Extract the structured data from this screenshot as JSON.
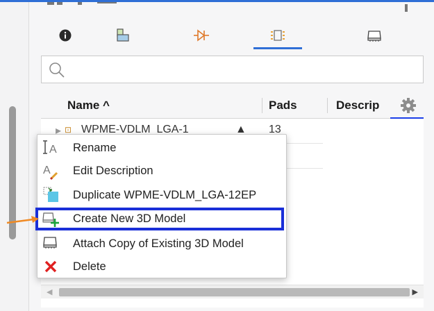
{
  "tabs": [
    {
      "icon": "info-icon"
    },
    {
      "icon": "component-icon"
    },
    {
      "icon": "schematic-symbol-icon"
    },
    {
      "icon": "footprint-icon",
      "active": true
    },
    {
      "icon": "3d-model-icon"
    }
  ],
  "search": {
    "placeholder": ""
  },
  "table": {
    "columns": {
      "name": "Name ^",
      "pads": "Pads",
      "description": "Descrip"
    },
    "rows": [
      {
        "name": "WPME-VDLM_LGA-1",
        "pads": "13"
      }
    ]
  },
  "context_menu": {
    "items": [
      {
        "label": "Rename",
        "icon": "rename-icon"
      },
      {
        "label": "Edit Description",
        "icon": "edit-description-icon"
      },
      {
        "label": "Duplicate WPME-VDLM_LGA-12EP",
        "icon": "duplicate-icon"
      },
      {
        "label": "Create New 3D Model",
        "icon": "create-3d-model-icon",
        "highlighted": true
      },
      {
        "label": "Attach Copy of Existing 3D Model",
        "icon": "attach-3d-model-icon"
      },
      {
        "label": "Delete",
        "icon": "delete-icon"
      }
    ]
  },
  "colors": {
    "accent": "#2f6fd6",
    "highlight": "#1a2fd8",
    "arrow": "#f08a24",
    "delete": "#e02020"
  }
}
